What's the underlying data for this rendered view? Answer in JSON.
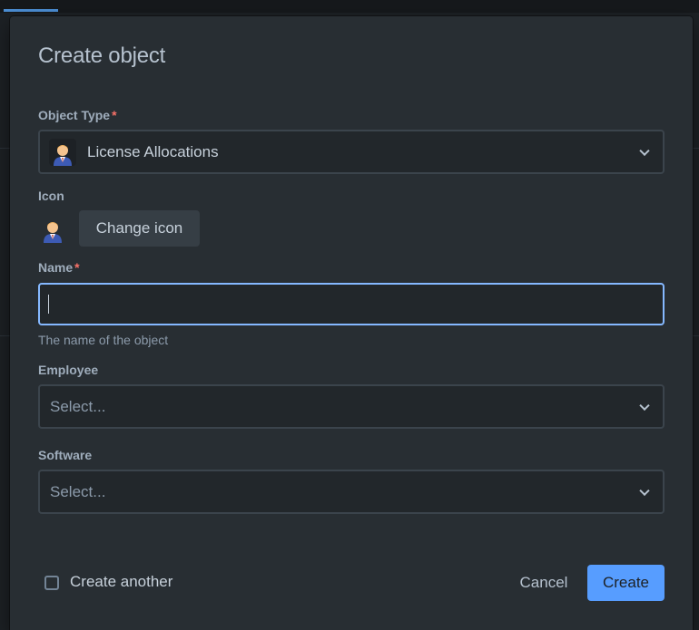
{
  "modal": {
    "title": "Create object",
    "object_type": {
      "label": "Object Type",
      "required_mark": "*",
      "value": "License Allocations",
      "icon": "businessman-avatar-icon"
    },
    "icon_section": {
      "label": "Icon",
      "icon": "businessman-avatar-icon",
      "change_button": "Change icon"
    },
    "name": {
      "label": "Name",
      "required_mark": "*",
      "value": "",
      "helper": "The name of the object"
    },
    "employee": {
      "label": "Employee",
      "placeholder": "Select..."
    },
    "software": {
      "label": "Software",
      "placeholder": "Select..."
    },
    "footer": {
      "create_another_label": "Create another",
      "create_another_checked": false,
      "cancel_label": "Cancel",
      "create_label": "Create"
    }
  },
  "colors": {
    "accent": "#579dff",
    "focus_border": "#85b8ff",
    "required": "#f87168",
    "modal_bg": "#282e33"
  }
}
